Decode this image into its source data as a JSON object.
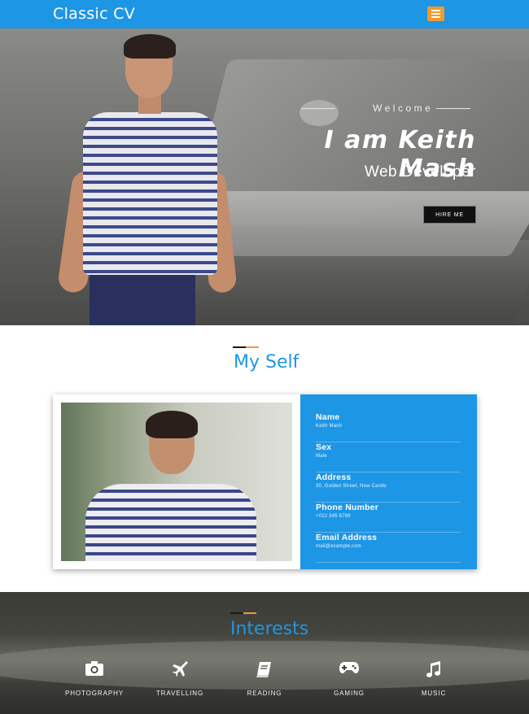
{
  "navbar": {
    "brand": "Classic CV",
    "menu_icon": "hamburger-icon"
  },
  "hero": {
    "welcome": "Welcome",
    "name": "I am Keith Mash",
    "role": "Web Developer",
    "hire_button": "HIRE ME"
  },
  "about": {
    "title": "My Self",
    "items": [
      {
        "label": "Name",
        "value": "Keith Mash"
      },
      {
        "label": "Sex",
        "value": "Male"
      },
      {
        "label": "Address",
        "value": "30, Golden Street, New Castle"
      },
      {
        "label": "Phone Number",
        "value": "+012 345 6789"
      },
      {
        "label": "Email Address",
        "value": "mail@example.com"
      }
    ]
  },
  "interests": {
    "title": "Interests",
    "items": [
      {
        "label": "PHOTOGRAPHY",
        "icon": "camera-icon"
      },
      {
        "label": "TRAVELLING",
        "icon": "plane-icon"
      },
      {
        "label": "READING",
        "icon": "book-icon"
      },
      {
        "label": "GAMING",
        "icon": "gamepad-icon"
      },
      {
        "label": "MUSIC",
        "icon": "music-icon"
      }
    ]
  },
  "colors": {
    "primary": "#1e96e6",
    "accent": "#f29a2e",
    "dark": "#111111"
  }
}
